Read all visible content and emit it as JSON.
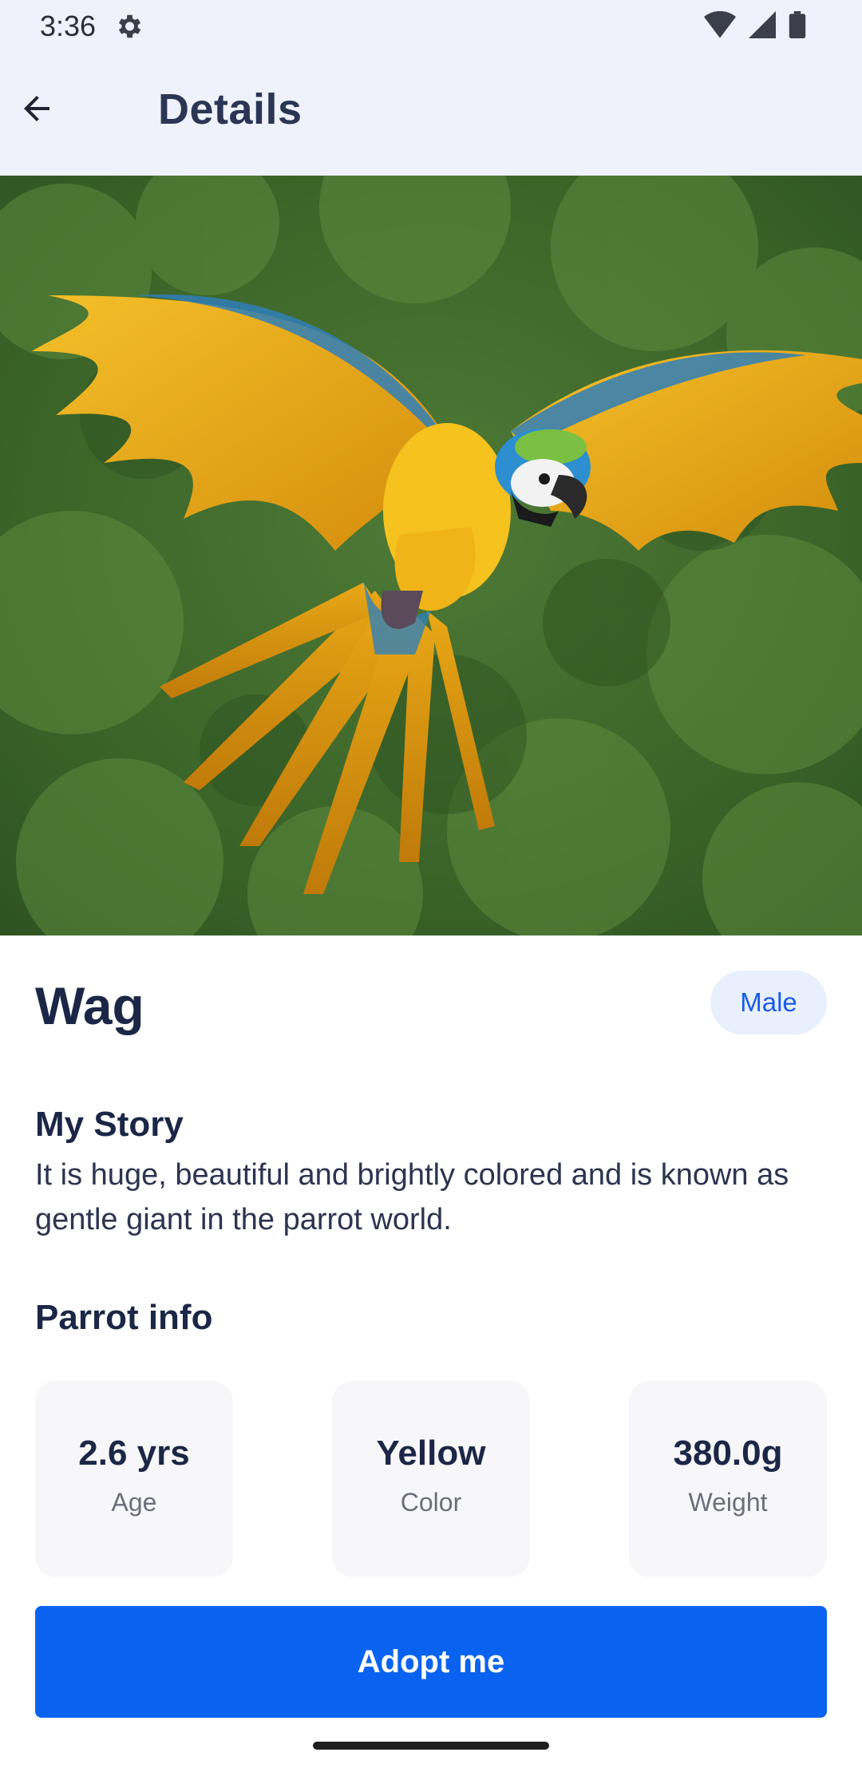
{
  "status_bar": {
    "time": "3:36",
    "icons": [
      "settings-gear-icon",
      "wifi-icon",
      "signal-icon",
      "battery-icon"
    ]
  },
  "app_bar": {
    "back_icon": "arrow-back-icon",
    "title": "Details"
  },
  "hero": {
    "subject": "macaw-flying-photo"
  },
  "pet": {
    "name": "Wag",
    "gender": "Male",
    "story_title": "My Story",
    "story_text": "It is huge, beautiful and brightly colored and is known as gentle giant in the parrot world.",
    "info_title": "Parrot info",
    "info": [
      {
        "value": "2.6 yrs",
        "label": "Age"
      },
      {
        "value": "Yellow",
        "label": "Color"
      },
      {
        "value": "380.0g",
        "label": "Weight"
      }
    ]
  },
  "actions": {
    "adopt_label": "Adopt me"
  },
  "colors": {
    "accent": "#0A63F0",
    "badge_bg": "#E8F0FE",
    "header_bg": "#EFF2FA",
    "title_text": "#1C2747"
  }
}
